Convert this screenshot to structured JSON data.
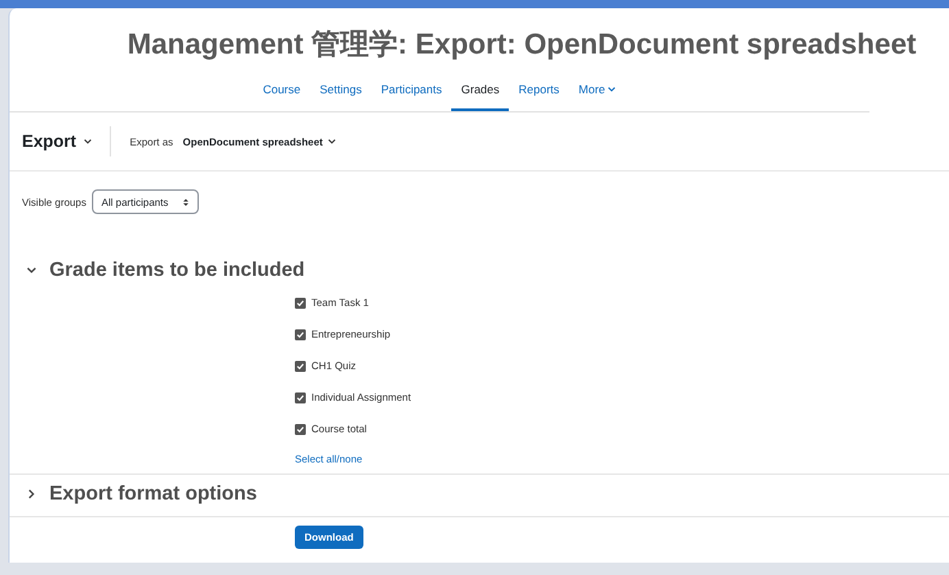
{
  "page_title": "Management 管理学: Export: OpenDocument spreadsheet",
  "tabs": [
    {
      "label": "Course",
      "selected": false
    },
    {
      "label": "Settings",
      "selected": false
    },
    {
      "label": "Participants",
      "selected": false
    },
    {
      "label": "Grades",
      "selected": true
    },
    {
      "label": "Reports",
      "selected": false
    },
    {
      "label": "More",
      "selected": false
    }
  ],
  "export_menu": {
    "label": "Export",
    "export_as_label": "Export as",
    "format": "OpenDocument spreadsheet"
  },
  "visible_groups": {
    "label": "Visible groups",
    "value": "All participants"
  },
  "sections": [
    {
      "title": "Grade items to be included",
      "expanded": true,
      "items": [
        {
          "label": "Team Task 1",
          "checked": true
        },
        {
          "label": "Entrepreneurship",
          "checked": true
        },
        {
          "label": "CH1 Quiz",
          "checked": true
        },
        {
          "label": "Individual Assignment",
          "checked": true
        },
        {
          "label": "Course total",
          "checked": true
        }
      ],
      "select_all": "Select all/none"
    },
    {
      "title": "Export format options",
      "expanded": false
    }
  ],
  "download_button": "Download"
}
